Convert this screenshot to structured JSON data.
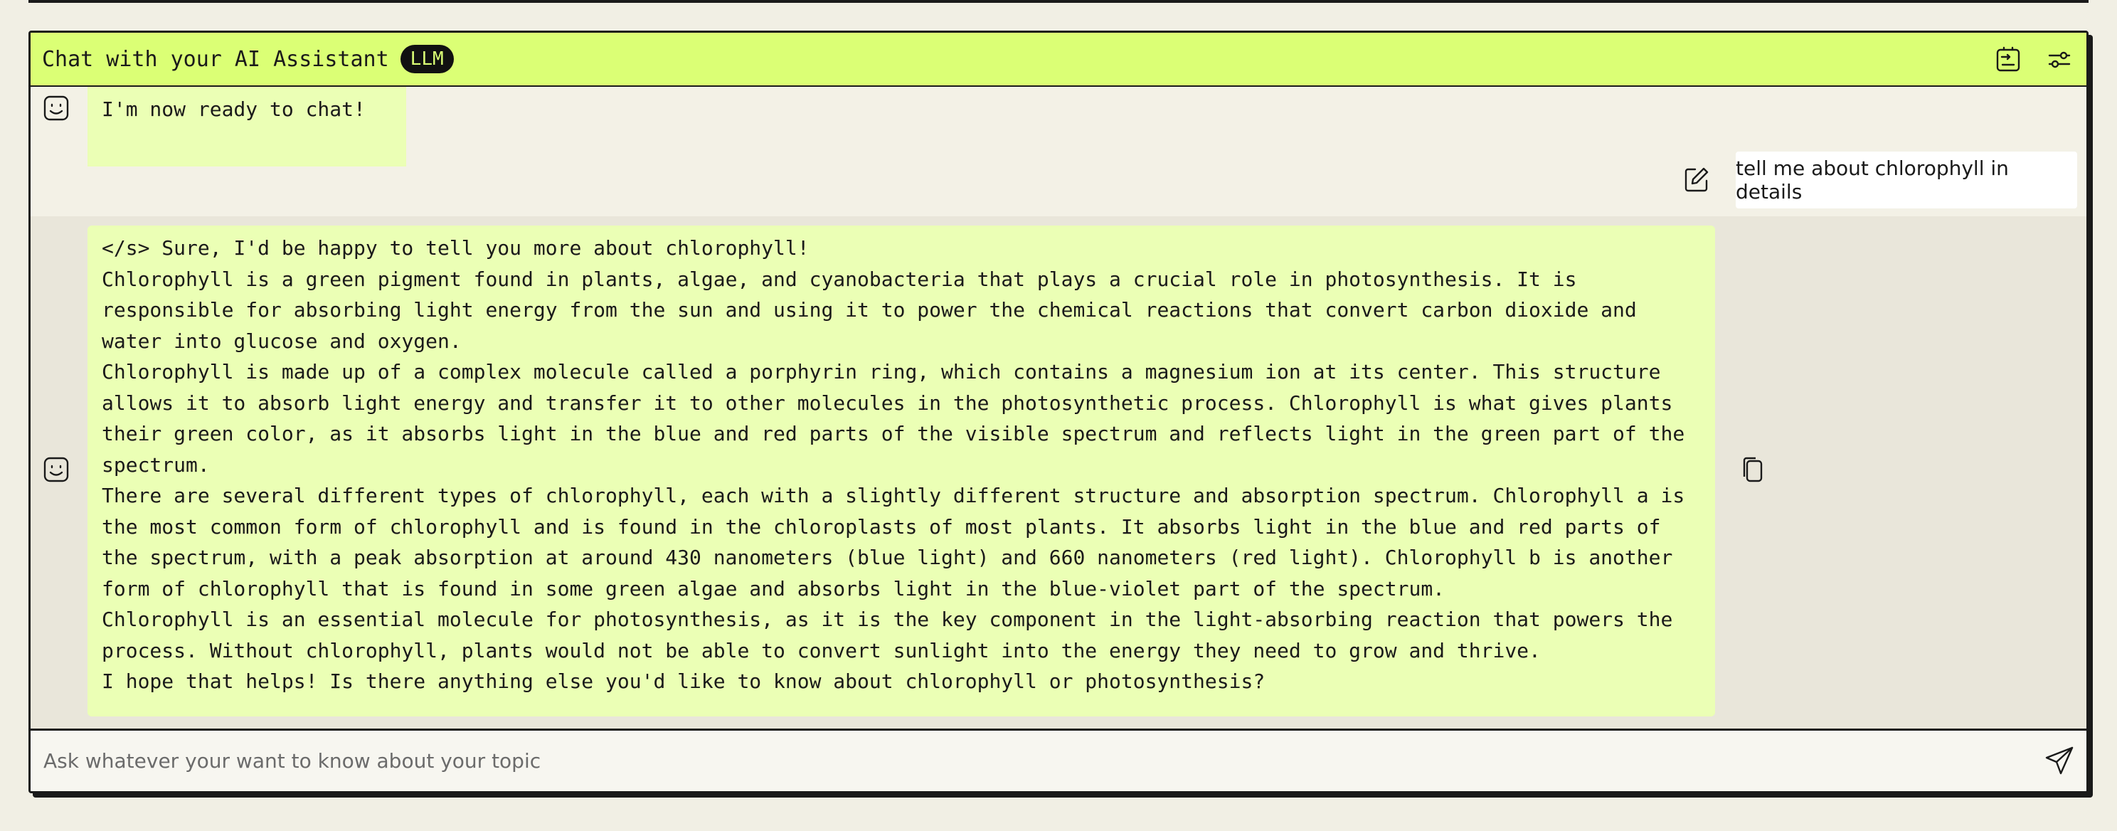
{
  "header": {
    "title": "Chat with your AI Assistant",
    "badge": "LLM",
    "icons": [
      "export-chat-icon",
      "settings-sliders-icon"
    ]
  },
  "messages": [
    {
      "role": "assistant",
      "text": "I'm now ready to chat!"
    },
    {
      "role": "user",
      "text": "tell me about chlorophyll in details"
    },
    {
      "role": "assistant",
      "paragraphs": [
        "</s> Sure, I'd be happy to tell you more about chlorophyll!",
        "Chlorophyll is a green pigment found in plants, algae, and cyanobacteria that plays a crucial role in photosynthesis. It is responsible for absorbing light energy from the sun and using it to power the chemical reactions that convert carbon dioxide and water into glucose and oxygen.",
        "Chlorophyll is made up of a complex molecule called a porphyrin ring, which contains a magnesium ion at its center. This structure allows it to absorb light energy and transfer it to other molecules in the photosynthetic process. Chlorophyll is what gives plants their green color, as it absorbs light in the blue and red parts of the visible spectrum and reflects light in the green part of the spectrum.",
        "There are several different types of chlorophyll, each with a slightly different structure and absorption spectrum. Chlorophyll a is the most common form of chlorophyll and is found in the chloroplasts of most plants. It absorbs light in the blue and red parts of the spectrum, with a peak absorption at around 430 nanometers (blue light) and 660 nanometers (red light). Chlorophyll b is another form of chlorophyll that is found in some green algae and absorbs light in the blue-violet part of the spectrum.",
        "Chlorophyll is an essential molecule for photosynthesis, as it is the key component in the light-absorbing reaction that powers the process. Without chlorophyll, plants would not be able to convert sunlight into the energy they need to grow and thrive.",
        "I hope that helps! Is there anything else you'd like to know about chlorophyll or photosynthesis?"
      ]
    }
  ],
  "input": {
    "placeholder": "Ask whatever your want to know about your topic",
    "value": ""
  },
  "colors": {
    "accent": "#dbff75",
    "bubble": "#ebffb5",
    "background": "#f1efe4",
    "ink": "#1a1a1a"
  }
}
